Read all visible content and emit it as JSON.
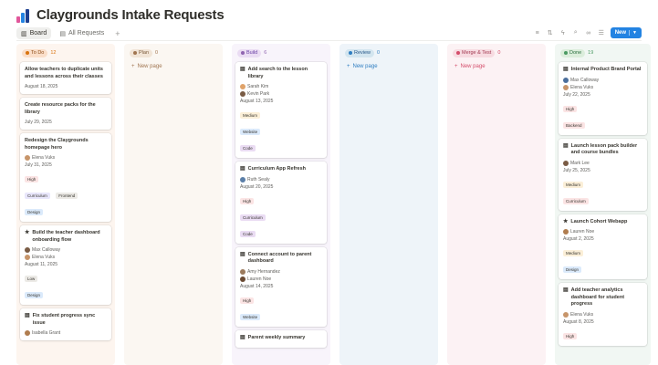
{
  "page": {
    "title": "Claygrounds Intake Requests",
    "views": [
      {
        "label": "Board",
        "active": true
      },
      {
        "label": "All Requests",
        "active": false
      }
    ],
    "add_view": "+",
    "toolbar": {
      "filter_icon": "filter-icon",
      "sort_icon": "sort-icon",
      "automation_icon": "lightning-icon",
      "search_icon": "search-icon",
      "link_icon": "link-icon",
      "more_icon": "sliders-icon",
      "new_label": "New"
    }
  },
  "colors": {
    "accent": "#2383e2",
    "todo": "#fdf5ef",
    "plan": "#fbf7f2",
    "build": "#f8f4fb",
    "review": "#eef4f9",
    "merge": "#fcf2f4",
    "done": "#f1f7f3"
  },
  "columns": [
    {
      "name": "To Do",
      "count": "12",
      "cards": [
        {
          "title": "Allow teachers to duplicate units and lessons across their classes",
          "props": [
            {
              "text": "August 18, 2025"
            }
          ]
        },
        {
          "title": "Create resource packs for the library",
          "props": [
            {
              "text": "July 29, 2025"
            }
          ]
        },
        {
          "title": "Redesign the Claygrounds homepage hero",
          "props": [
            {
              "text": "Elena Vuks",
              "avatar": true
            },
            {
              "text": "July 31, 2025"
            }
          ],
          "tags": [
            {
              "text": "High",
              "color": "#fbe4e4"
            },
            {
              "text": "Curriculum",
              "color": "#e8e6fb"
            },
            {
              "text": "Frontend",
              "color": "#eceae6"
            },
            {
              "text": "Design",
              "color": "#dbeafb"
            }
          ]
        },
        {
          "title": "Build the teacher dashboard onboarding flow",
          "props": [
            {
              "text": "Max Calloway",
              "avatar": true
            },
            {
              "text": "Elena Vuks",
              "avatar": true
            },
            {
              "text": "August 11, 2025"
            }
          ],
          "tags": [
            {
              "text": "Low",
              "color": "#eceae6"
            },
            {
              "text": "Design",
              "color": "#dbeafb"
            }
          ]
        },
        {
          "title": "Fix student progress sync issue",
          "props": [
            {
              "text": "Isabella Grant",
              "avatar": true
            }
          ],
          "ico": "page"
        }
      ]
    },
    {
      "name": "Plan",
      "count": "0",
      "new": "New page",
      "cards": []
    },
    {
      "name": "Build",
      "count": "6",
      "cards": [
        {
          "title": "Add search to the lesson library",
          "ico": "page",
          "props": [
            {
              "text": "Sarah Kim",
              "avatar": true
            },
            {
              "text": "Kevin Park",
              "avatar": true
            },
            {
              "text": "August 13, 2025"
            }
          ],
          "tags": [
            {
              "text": "Medium",
              "color": "#fbefd8"
            },
            {
              "text": "Website",
              "color": "#dbeafb"
            },
            {
              "text": "Code",
              "color": "#eadcf3"
            }
          ]
        },
        {
          "title": "Curriculum App Refresh",
          "ico": "page",
          "props": [
            {
              "text": "Ruth Sealy",
              "avatar": true
            },
            {
              "text": "August 20, 2025"
            }
          ],
          "tags": [
            {
              "text": "High",
              "color": "#fbe4e4"
            },
            {
              "text": "Curriculum",
              "color": "#eadcf3"
            },
            {
              "text": "Code",
              "color": "#eadcf3"
            }
          ]
        },
        {
          "title": "Connect account to parent dashboard",
          "ico": "page",
          "props": [
            {
              "text": "Amy Hernandez",
              "avatar": true
            },
            {
              "text": "Lauren Noe",
              "avatar": true
            },
            {
              "text": "August 14, 2025"
            }
          ],
          "tags": [
            {
              "text": "High",
              "color": "#fbe4e4"
            },
            {
              "text": "Website",
              "color": "#dbeafb"
            }
          ]
        },
        {
          "title": "Parent weekly summary",
          "ico": "page",
          "props": []
        }
      ]
    },
    {
      "name": "Review",
      "count": "0",
      "new": "New page",
      "cards": []
    },
    {
      "name": "Merge & Test",
      "count": "0",
      "new": "New page",
      "cards": []
    },
    {
      "name": "Done",
      "count": "19",
      "cards": [
        {
          "title": "Internal Product Brand Portal",
          "ico": "page",
          "props": [
            {
              "text": "Max Calloway",
              "avatar": true
            },
            {
              "text": "Elena Vuks",
              "avatar": true
            },
            {
              "text": "July 22, 2025"
            }
          ],
          "tags": [
            {
              "text": "High",
              "color": "#fbe4e4"
            },
            {
              "text": "Backend",
              "color": "#fbe4e4"
            }
          ]
        },
        {
          "title": "Launch lesson pack builder and course bundles",
          "ico": "page",
          "props": [
            {
              "text": "Mark Lee",
              "avatar": true
            },
            {
              "text": "July 25, 2025"
            }
          ],
          "tags": [
            {
              "text": "Medium",
              "color": "#fbefd8"
            },
            {
              "text": "Curriculum",
              "color": "#fbe4e4"
            }
          ]
        },
        {
          "title": "Launch Cohort Webapp",
          "ico": "star",
          "props": [
            {
              "text": "Lauren Noe",
              "avatar": true
            },
            {
              "text": "August 2, 2025"
            }
          ],
          "tags": [
            {
              "text": "Medium",
              "color": "#fbefd8"
            },
            {
              "text": "Design",
              "color": "#dbeafb"
            }
          ]
        },
        {
          "title": "Add teacher analytics dashboard for student progress",
          "ico": "page",
          "props": [
            {
              "text": "Elena Vuks",
              "avatar": true
            },
            {
              "text": "August 8, 2025"
            }
          ],
          "tags": [
            {
              "text": "High",
              "color": "#fbe4e4"
            }
          ]
        }
      ]
    }
  ]
}
